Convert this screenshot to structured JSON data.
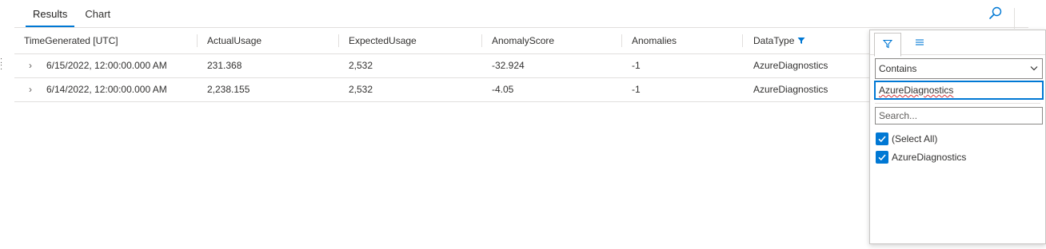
{
  "tabs": [
    {
      "label": "Results",
      "active": true
    },
    {
      "label": "Chart",
      "active": false
    }
  ],
  "icons": {
    "search": "search-icon",
    "expander": "chevron-right-icon",
    "column_filter": "filter-icon",
    "panel_filter_tab": "filter-icon",
    "panel_columns_tab": "menu-icon",
    "dropdown": "chevron-down-icon",
    "checkbox": "checkmark-icon"
  },
  "colors": {
    "accent": "#0078d4",
    "border": "#e1dfdd",
    "text": "#323130",
    "spellcheck": "#d13438"
  },
  "grid": {
    "columns": [
      "TimeGenerated [UTC]",
      "ActualUsage",
      "ExpectedUsage",
      "AnomalyScore",
      "Anomalies",
      "DataType"
    ],
    "filtered_column": "DataType",
    "rows": [
      [
        "6/15/2022, 12:00:00.000 AM",
        "231.368",
        "2,532",
        "-32.924",
        "-1",
        "AzureDiagnostics"
      ],
      [
        "6/14/2022, 12:00:00.000 AM",
        "2,238.155",
        "2,532",
        "-4.05",
        "-1",
        "AzureDiagnostics"
      ]
    ]
  },
  "filter_panel": {
    "operator": "Contains",
    "value": "AzureDiagnostics",
    "search_placeholder": "Search...",
    "options": [
      {
        "label": "(Select All)",
        "checked": true
      },
      {
        "label": "AzureDiagnostics",
        "checked": true
      }
    ]
  }
}
